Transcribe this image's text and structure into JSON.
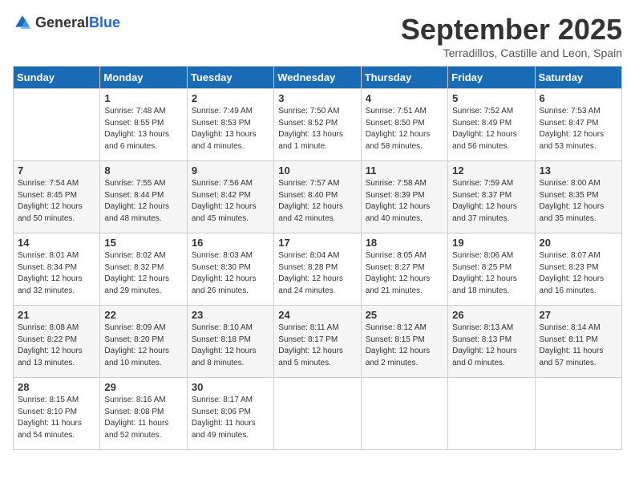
{
  "logo": {
    "general": "General",
    "blue": "Blue"
  },
  "header": {
    "month": "September 2025",
    "location": "Terradillos, Castille and Leon, Spain"
  },
  "days_of_week": [
    "Sunday",
    "Monday",
    "Tuesday",
    "Wednesday",
    "Thursday",
    "Friday",
    "Saturday"
  ],
  "weeks": [
    [
      {
        "day": "",
        "info": ""
      },
      {
        "day": "1",
        "info": "Sunrise: 7:48 AM\nSunset: 8:55 PM\nDaylight: 13 hours\nand 6 minutes."
      },
      {
        "day": "2",
        "info": "Sunrise: 7:49 AM\nSunset: 8:53 PM\nDaylight: 13 hours\nand 4 minutes."
      },
      {
        "day": "3",
        "info": "Sunrise: 7:50 AM\nSunset: 8:52 PM\nDaylight: 13 hours\nand 1 minute."
      },
      {
        "day": "4",
        "info": "Sunrise: 7:51 AM\nSunset: 8:50 PM\nDaylight: 12 hours\nand 58 minutes."
      },
      {
        "day": "5",
        "info": "Sunrise: 7:52 AM\nSunset: 8:49 PM\nDaylight: 12 hours\nand 56 minutes."
      },
      {
        "day": "6",
        "info": "Sunrise: 7:53 AM\nSunset: 8:47 PM\nDaylight: 12 hours\nand 53 minutes."
      }
    ],
    [
      {
        "day": "7",
        "info": "Sunrise: 7:54 AM\nSunset: 8:45 PM\nDaylight: 12 hours\nand 50 minutes."
      },
      {
        "day": "8",
        "info": "Sunrise: 7:55 AM\nSunset: 8:44 PM\nDaylight: 12 hours\nand 48 minutes."
      },
      {
        "day": "9",
        "info": "Sunrise: 7:56 AM\nSunset: 8:42 PM\nDaylight: 12 hours\nand 45 minutes."
      },
      {
        "day": "10",
        "info": "Sunrise: 7:57 AM\nSunset: 8:40 PM\nDaylight: 12 hours\nand 42 minutes."
      },
      {
        "day": "11",
        "info": "Sunrise: 7:58 AM\nSunset: 8:39 PM\nDaylight: 12 hours\nand 40 minutes."
      },
      {
        "day": "12",
        "info": "Sunrise: 7:59 AM\nSunset: 8:37 PM\nDaylight: 12 hours\nand 37 minutes."
      },
      {
        "day": "13",
        "info": "Sunrise: 8:00 AM\nSunset: 8:35 PM\nDaylight: 12 hours\nand 35 minutes."
      }
    ],
    [
      {
        "day": "14",
        "info": "Sunrise: 8:01 AM\nSunset: 8:34 PM\nDaylight: 12 hours\nand 32 minutes."
      },
      {
        "day": "15",
        "info": "Sunrise: 8:02 AM\nSunset: 8:32 PM\nDaylight: 12 hours\nand 29 minutes."
      },
      {
        "day": "16",
        "info": "Sunrise: 8:03 AM\nSunset: 8:30 PM\nDaylight: 12 hours\nand 26 minutes."
      },
      {
        "day": "17",
        "info": "Sunrise: 8:04 AM\nSunset: 8:28 PM\nDaylight: 12 hours\nand 24 minutes."
      },
      {
        "day": "18",
        "info": "Sunrise: 8:05 AM\nSunset: 8:27 PM\nDaylight: 12 hours\nand 21 minutes."
      },
      {
        "day": "19",
        "info": "Sunrise: 8:06 AM\nSunset: 8:25 PM\nDaylight: 12 hours\nand 18 minutes."
      },
      {
        "day": "20",
        "info": "Sunrise: 8:07 AM\nSunset: 8:23 PM\nDaylight: 12 hours\nand 16 minutes."
      }
    ],
    [
      {
        "day": "21",
        "info": "Sunrise: 8:08 AM\nSunset: 8:22 PM\nDaylight: 12 hours\nand 13 minutes."
      },
      {
        "day": "22",
        "info": "Sunrise: 8:09 AM\nSunset: 8:20 PM\nDaylight: 12 hours\nand 10 minutes."
      },
      {
        "day": "23",
        "info": "Sunrise: 8:10 AM\nSunset: 8:18 PM\nDaylight: 12 hours\nand 8 minutes."
      },
      {
        "day": "24",
        "info": "Sunrise: 8:11 AM\nSunset: 8:17 PM\nDaylight: 12 hours\nand 5 minutes."
      },
      {
        "day": "25",
        "info": "Sunrise: 8:12 AM\nSunset: 8:15 PM\nDaylight: 12 hours\nand 2 minutes."
      },
      {
        "day": "26",
        "info": "Sunrise: 8:13 AM\nSunset: 8:13 PM\nDaylight: 12 hours\nand 0 minutes."
      },
      {
        "day": "27",
        "info": "Sunrise: 8:14 AM\nSunset: 8:11 PM\nDaylight: 11 hours\nand 57 minutes."
      }
    ],
    [
      {
        "day": "28",
        "info": "Sunrise: 8:15 AM\nSunset: 8:10 PM\nDaylight: 11 hours\nand 54 minutes."
      },
      {
        "day": "29",
        "info": "Sunrise: 8:16 AM\nSunset: 8:08 PM\nDaylight: 11 hours\nand 52 minutes."
      },
      {
        "day": "30",
        "info": "Sunrise: 8:17 AM\nSunset: 8:06 PM\nDaylight: 11 hours\nand 49 minutes."
      },
      {
        "day": "",
        "info": ""
      },
      {
        "day": "",
        "info": ""
      },
      {
        "day": "",
        "info": ""
      },
      {
        "day": "",
        "info": ""
      }
    ]
  ]
}
